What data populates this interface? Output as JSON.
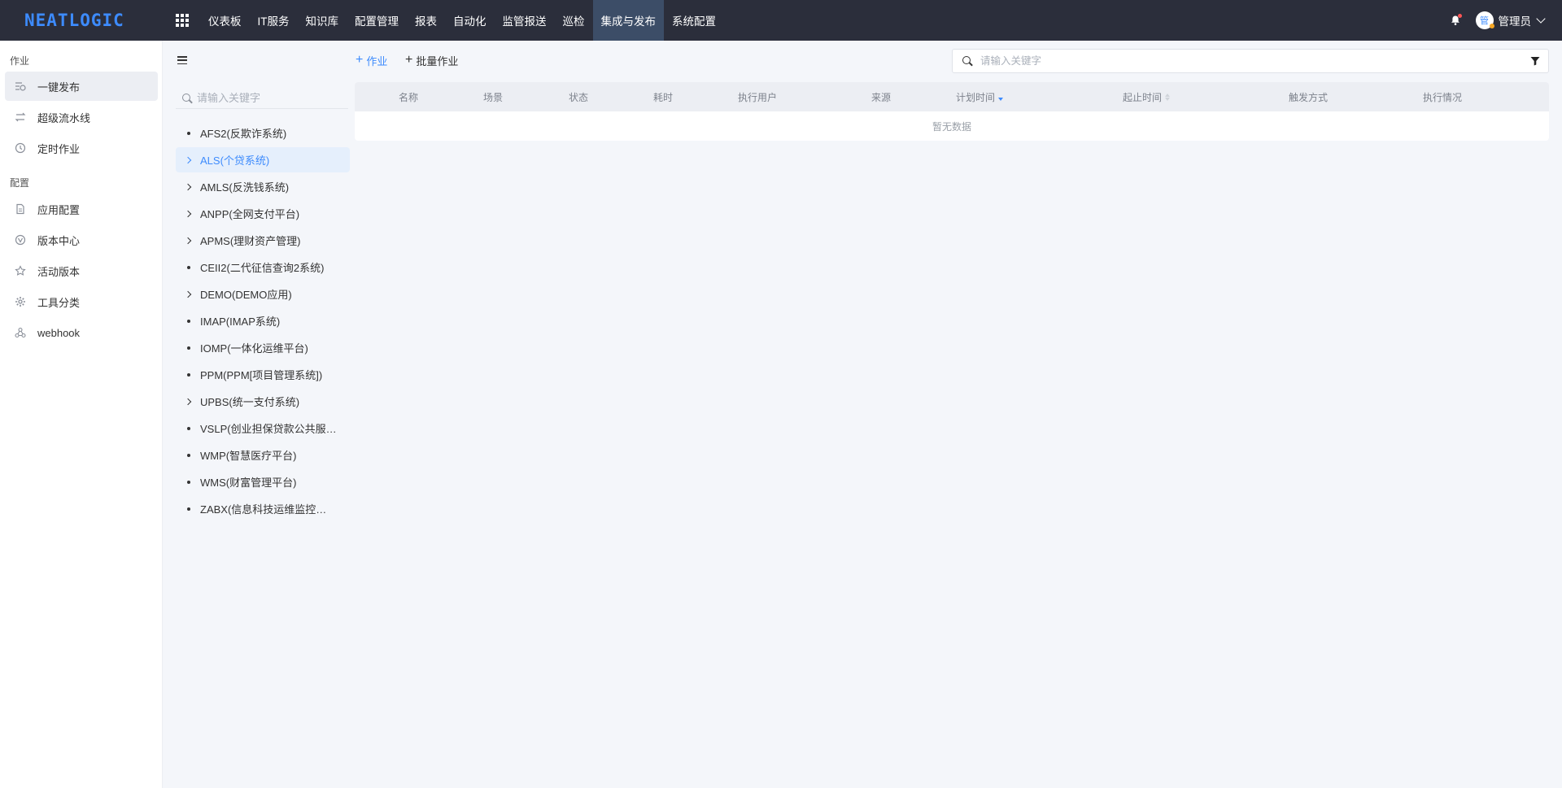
{
  "app": {
    "logo_text": "NEATLOGIC"
  },
  "nav": {
    "items": [
      {
        "label": "仪表板"
      },
      {
        "label": "IT服务"
      },
      {
        "label": "知识库"
      },
      {
        "label": "配置管理"
      },
      {
        "label": "报表"
      },
      {
        "label": "自动化"
      },
      {
        "label": "监管报送"
      },
      {
        "label": "巡检"
      },
      {
        "label": "集成与发布",
        "active": true
      },
      {
        "label": "系统配置"
      }
    ]
  },
  "user": {
    "avatar_text": "管",
    "name": "管理员"
  },
  "sidebar": {
    "group_job": "作业",
    "group_config": "配置",
    "items": [
      {
        "label": "一键发布",
        "icon": "one-click-deploy-icon",
        "active": true
      },
      {
        "label": "超级流水线",
        "icon": "pipeline-icon"
      },
      {
        "label": "定时作业",
        "icon": "clock-icon"
      },
      {
        "label": "应用配置",
        "icon": "document-icon"
      },
      {
        "label": "版本中心",
        "icon": "version-icon"
      },
      {
        "label": "活动版本",
        "icon": "star-icon"
      },
      {
        "label": "工具分类",
        "icon": "gear-icon"
      },
      {
        "label": "webhook",
        "icon": "webhook-icon"
      }
    ]
  },
  "tree": {
    "search_placeholder": "请输入关键字",
    "items": [
      {
        "label": "AFS2(反欺诈系统)",
        "expandable": false
      },
      {
        "label": "ALS(个贷系统)",
        "expandable": true,
        "active": true
      },
      {
        "label": "AMLS(反洗钱系统)",
        "expandable": true
      },
      {
        "label": "ANPP(全网支付平台)",
        "expandable": true
      },
      {
        "label": "APMS(理财资产管理)",
        "expandable": true
      },
      {
        "label": "CEII2(二代征信查询2系统)",
        "expandable": false
      },
      {
        "label": "DEMO(DEMO应用)",
        "expandable": true
      },
      {
        "label": "IMAP(IMAP系统)",
        "expandable": false
      },
      {
        "label": "IOMP(一体化运维平台)",
        "expandable": false
      },
      {
        "label": "PPM(PPM[项目管理系统])",
        "expandable": false
      },
      {
        "label": "UPBS(统一支付系统)",
        "expandable": true
      },
      {
        "label": "VSLP(创业担保贷款公共服务平台)",
        "expandable": false
      },
      {
        "label": "WMP(智慧医疗平台)",
        "expandable": false
      },
      {
        "label": "WMS(财富管理平台)",
        "expandable": false
      },
      {
        "label": "ZABX(信息科技运维监控系统)",
        "expandable": false
      }
    ]
  },
  "toolbar": {
    "add_job_label": "作业",
    "batch_job_label": "批量作业",
    "search_placeholder": "请输入关键字"
  },
  "table": {
    "columns": [
      {
        "label": "名称"
      },
      {
        "label": "场景"
      },
      {
        "label": "状态"
      },
      {
        "label": "耗时"
      },
      {
        "label": "执行用户"
      },
      {
        "label": "来源"
      },
      {
        "label": "计划时间",
        "sort": "desc"
      },
      {
        "label": "起止时间",
        "sort": "none"
      },
      {
        "label": "触发方式"
      },
      {
        "label": "执行情况"
      }
    ],
    "empty_text": "暂无数据"
  },
  "colors": {
    "accent": "#3d8bfd",
    "topbar": "#2b2e3b",
    "active_nav": "#3c4d67"
  }
}
